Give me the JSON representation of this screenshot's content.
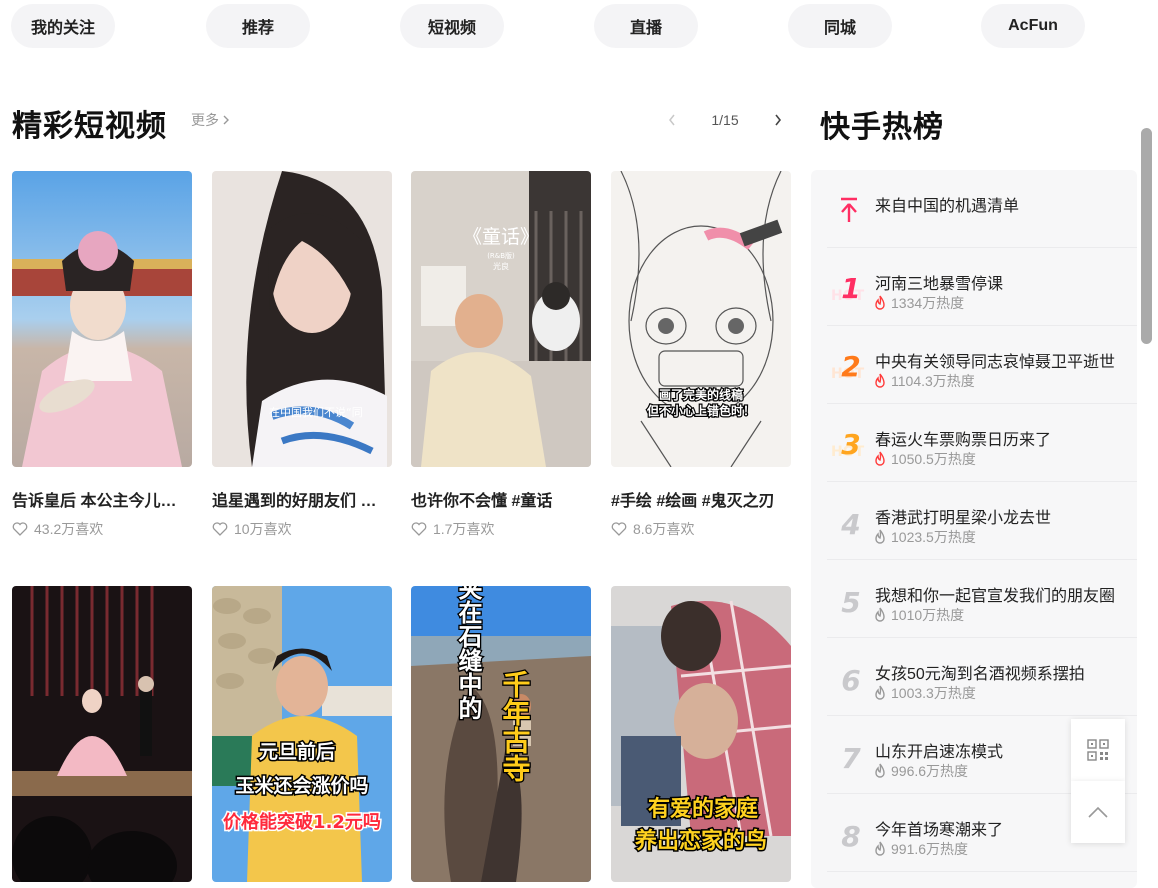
{
  "nav": {
    "tabs": [
      {
        "label": "我的关注"
      },
      {
        "label": "推荐"
      },
      {
        "label": "短视频"
      },
      {
        "label": "直播"
      },
      {
        "label": "同城"
      },
      {
        "label": "AcFun"
      }
    ]
  },
  "section": {
    "title": "精彩短视频",
    "more_label": "更多",
    "pager": {
      "current": "1/15"
    }
  },
  "videos": [
    {
      "title": "告诉皇后 本公主今儿也来了",
      "likes": "43.2万喜欢"
    },
    {
      "title": "追星遇到的好朋友们 在中国我们不说",
      "likes": "10万喜欢",
      "overlay": "在中国我们不说“同"
    },
    {
      "title": "也许你不会懂 #童话",
      "likes": "1.7万喜欢",
      "overlay": "《童话》",
      "overlay_sub": "(R&B版)",
      "overlay_sub2": "光良"
    },
    {
      "title": "#手绘 #绘画 #鬼灭之刃",
      "likes": "8.6万喜欢",
      "overlay": "画了完美的线稿",
      "overlay2": "但不小心上错色时！"
    },
    {
      "title": "",
      "likes": ""
    },
    {
      "title": "",
      "likes": "",
      "overlay": "元旦前后",
      "overlay2": "玉米还会涨价吗",
      "overlay3": "价格能突破1.2元吗"
    },
    {
      "title": "",
      "likes": "",
      "overlay": "夹在石缝中的",
      "overlay2": "千年古寺"
    },
    {
      "title": "",
      "likes": "",
      "overlay": "有爱的家庭",
      "overlay2": "养出恋家的鸟"
    }
  ],
  "hot": {
    "title": "快手热榜",
    "items": [
      {
        "title": "来自中国的机遇清单",
        "heat": "",
        "rank": "top"
      },
      {
        "title": "河南三地暴雪停课",
        "heat": "1334万热度",
        "rank": "1"
      },
      {
        "title": "中央有关领导同志哀悼聂卫平逝世",
        "heat": "1104.3万热度",
        "rank": "2"
      },
      {
        "title": "春运火车票购票日历来了",
        "heat": "1050.5万热度",
        "rank": "3"
      },
      {
        "title": "香港武打明星梁小龙去世",
        "heat": "1023.5万热度",
        "rank": "4"
      },
      {
        "title": "我想和你一起官宣发我们的朋友圈",
        "heat": "1010万热度",
        "rank": "5"
      },
      {
        "title": "女孩50元淘到名酒视频系摆拍",
        "heat": "1003.3万热度",
        "rank": "6"
      },
      {
        "title": "山东开启速冻模式",
        "heat": "996.6万热度",
        "rank": "7"
      },
      {
        "title": "今年首场寒潮来了",
        "heat": "991.6万热度",
        "rank": "8"
      }
    ],
    "hot_watermark": "HOT"
  },
  "colors": {
    "rank1": "#ff2e63",
    "rank2": "#ff7a1a",
    "rank3": "#ffa51f",
    "rank_other": "#c9c9cc",
    "flame_hot": "#ff3a3a",
    "flame_normal": "#999999"
  },
  "icons": {
    "more": "chevron-right-icon",
    "prev": "chevron-left-icon",
    "next": "chevron-right-icon",
    "like": "heart-outline-icon",
    "heat": "flame-icon",
    "top": "arrow-top-icon",
    "qr": "qr-code-icon",
    "back_top": "chevron-up-icon"
  }
}
